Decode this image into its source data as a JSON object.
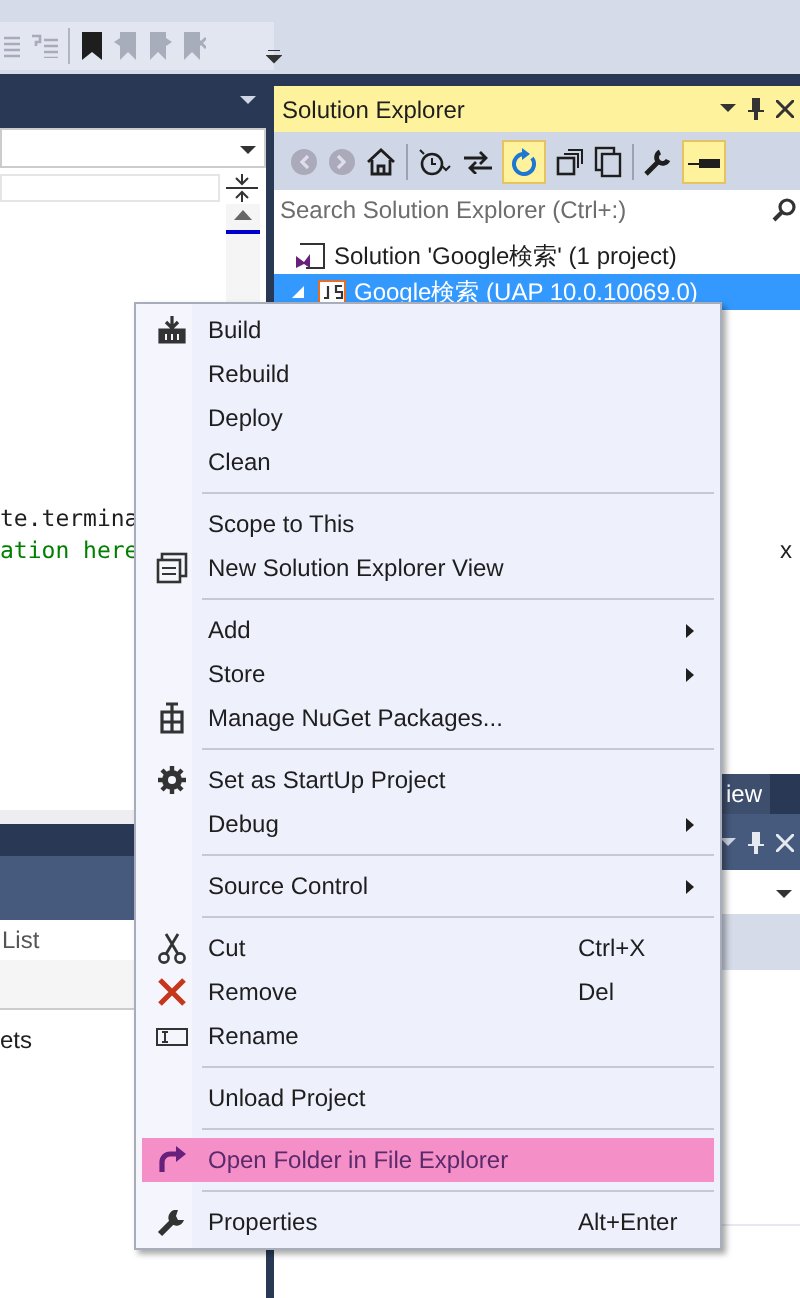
{
  "solution_explorer": {
    "title": "Solution Explorer",
    "search": {
      "placeholder": "Search Solution Explorer (Ctrl+:)"
    },
    "tree": [
      {
        "label": "Solution 'Google検索' (1 project)",
        "selected": false,
        "children": [
          {
            "label": "Google検索 (UAP 10.0.10069.0)",
            "selected": true,
            "expanded": true
          }
        ]
      }
    ],
    "peek_text": "x"
  },
  "editor": {
    "lines": [
      {
        "text": "te.termina",
        "kind": "code"
      },
      {
        "text": "ation here",
        "kind": "comment"
      }
    ]
  },
  "lower_left_panel": {
    "search": {
      "value": "List"
    },
    "items": [
      "ets"
    ]
  },
  "lower_right_panel": {
    "tab": "iew"
  },
  "context_menu": {
    "items": [
      {
        "kind": "item",
        "label": "Build",
        "selected": false
      },
      {
        "kind": "item",
        "label": "Rebuild",
        "selected": false
      },
      {
        "kind": "item",
        "label": "Deploy",
        "selected": false
      },
      {
        "kind": "item",
        "label": "Clean",
        "selected": false
      },
      {
        "kind": "separator"
      },
      {
        "kind": "item",
        "label": "Scope to This",
        "selected": false
      },
      {
        "kind": "item",
        "label": "New Solution Explorer View",
        "selected": false
      },
      {
        "kind": "separator"
      },
      {
        "kind": "submenu",
        "label": "Add",
        "selected": false
      },
      {
        "kind": "submenu",
        "label": "Store",
        "selected": false
      },
      {
        "kind": "item",
        "label": "Manage NuGet Packages...",
        "selected": false
      },
      {
        "kind": "separator"
      },
      {
        "kind": "item",
        "label": "Set as StartUp Project",
        "selected": false
      },
      {
        "kind": "submenu",
        "label": "Debug",
        "selected": false
      },
      {
        "kind": "separator"
      },
      {
        "kind": "submenu",
        "label": "Source Control",
        "selected": false
      },
      {
        "kind": "separator"
      },
      {
        "kind": "item",
        "label": "Cut",
        "shortcut": "Ctrl+X",
        "selected": false
      },
      {
        "kind": "item",
        "label": "Remove",
        "shortcut": "Del",
        "selected": false
      },
      {
        "kind": "item",
        "label": "Rename",
        "selected": false
      },
      {
        "kind": "separator"
      },
      {
        "kind": "item",
        "label": "Unload Project",
        "selected": false
      },
      {
        "kind": "separator"
      },
      {
        "kind": "item",
        "label": "Open Folder in File Explorer",
        "selected": true
      },
      {
        "kind": "separator"
      },
      {
        "kind": "item",
        "label": "Properties",
        "shortcut": "Alt+Enter",
        "selected": false
      }
    ]
  }
}
